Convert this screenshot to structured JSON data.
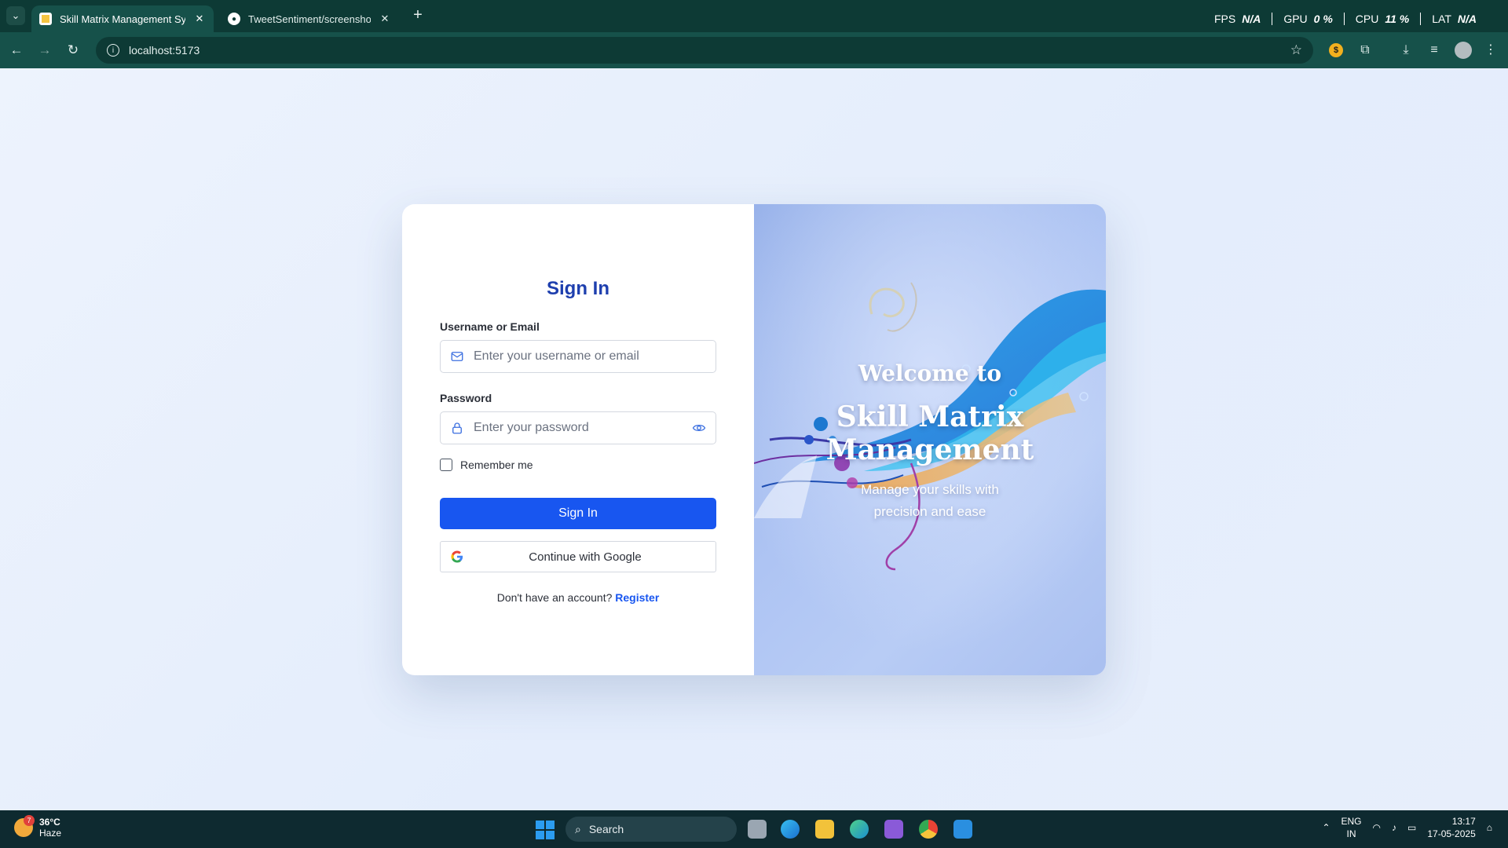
{
  "browser": {
    "tabs": [
      {
        "title": "Skill Matrix Management Syster",
        "active": true
      },
      {
        "title": "TweetSentiment/screenshots/Sc",
        "active": false
      }
    ],
    "performance": [
      {
        "label": "FPS",
        "value": "N/A"
      },
      {
        "label": "GPU",
        "value": "0 %"
      },
      {
        "label": "CPU",
        "value": "11 %"
      },
      {
        "label": "LAT",
        "value": "N/A"
      }
    ],
    "url": "localhost:5173"
  },
  "login": {
    "title": "Sign In",
    "username_label": "Username or Email",
    "username_placeholder": "Enter your username or email",
    "password_label": "Password",
    "password_placeholder": "Enter your password",
    "remember_label": "Remember me",
    "submit_label": "Sign In",
    "google_label": "Continue with Google",
    "no_account_text": "Don't have an account?",
    "register_link": "Register"
  },
  "hero": {
    "welcome": "Welcome to",
    "app_name_line1": "Skill Matrix",
    "app_name_line2": "Management",
    "tagline": "Manage your skills with precision and ease"
  },
  "taskbar": {
    "weather_temp": "36°C",
    "weather_desc": "Haze",
    "weather_badge": "7",
    "search_label": "Search",
    "lang_line1": "ENG",
    "lang_line2": "IN",
    "time": "13:17",
    "date": "17-05-2025"
  },
  "colors": {
    "primary": "#1856f0",
    "title": "#1e3fae",
    "chrome": "#16514a"
  }
}
